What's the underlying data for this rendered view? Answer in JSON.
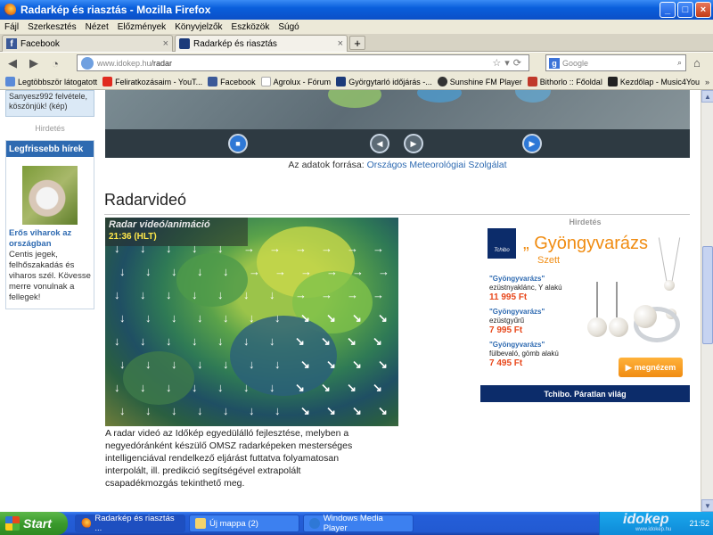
{
  "window": {
    "title": "Radarkép és riasztás - Mozilla Firefox",
    "buttons": {
      "minimize": "_",
      "maximize": "□",
      "close": "×"
    }
  },
  "menu": [
    "Fájl",
    "Szerkesztés",
    "Nézet",
    "Előzmények",
    "Könyvjelzők",
    "Eszközök",
    "Súgó"
  ],
  "tabs": [
    {
      "label": "Facebook",
      "active": false
    },
    {
      "label": "Radarkép és riasztás",
      "active": true
    }
  ],
  "navigation": {
    "url_host": "www.idokep.hu",
    "url_path": "/radar",
    "search_placeholder": "Google"
  },
  "bookmarks": [
    {
      "label": "Legtöbbször látogatott",
      "color": "#5a8ad8"
    },
    {
      "label": "Feliratkozásaim - YouT...",
      "color": "#e02a1f"
    },
    {
      "label": "Facebook",
      "color": "#3b5998"
    },
    {
      "label": "Agrolux - Fórum",
      "color": "#ffffff"
    },
    {
      "label": "Györgytarló időjárás -...",
      "color": "#1b3a7a"
    },
    {
      "label": "Sunshine FM Player",
      "color": "#333333"
    },
    {
      "label": "Bithorlo :: Főoldal",
      "color": "#c0392b"
    },
    {
      "label": "Kezdőlap - Music4You",
      "color": "#222222"
    }
  ],
  "sidebar": {
    "note_text": "Sanyesz992 felvétele, köszönjük! (kép)",
    "ad_label": "Hirdetés",
    "latest_news_title": "Legfrissebb hírek",
    "news_title": "Erős viharok az országban",
    "news_text": "Centis jegek, felhőszakadás és viharos szél. Kövesse merre vonulnak a fellegek!"
  },
  "source": {
    "prefix": "Az adatok forrása:",
    "link": "Országos Meteorológiai Szolgálat"
  },
  "radar_section": {
    "heading": "Radarvideó",
    "overlay_title": "Radar videó/animáció",
    "overlay_time": "21:36 (HLT)",
    "description": "A radar videó az Időkép egyedülálló fejlesztése, melyben a negyedóránként készülő OMSZ radarképeken mesterséges intelligenciával rendelkező eljárást futtatva folyamatosan interpolált, ill. predikció segítségével extrapolált csapadékmozgás tekinthető meg."
  },
  "ad": {
    "label": "Hirdetés",
    "brand": "Tchibo",
    "headline": "Gyöngyvarázs",
    "subhead": "Szett",
    "products": [
      {
        "name_q": "\"Gyöngyvarázs\"",
        "name": "ezüstnyaklánc, Y alakú",
        "price": "11 995 Ft"
      },
      {
        "name_q": "\"Gyöngyvarázs\"",
        "name": "ezüstgyűrű",
        "price": "7 995 Ft"
      },
      {
        "name_q": "\"Gyöngyvarázs\"",
        "name": "fülbevaló, gömb alakú",
        "price": "7 495 Ft"
      }
    ],
    "button": "megnézem",
    "footer": "Tchibo. Páratlan világ"
  },
  "taskbar": {
    "start": "Start",
    "tasks": [
      {
        "label": "Radarkép és riasztás ...",
        "active": true
      },
      {
        "label": "Új mappa (2)",
        "active": false
      },
      {
        "label": "Windows Media Player",
        "active": false
      }
    ],
    "tray_logo": "idokep",
    "tray_sub": "www.idokep.hu",
    "clock": "21:52"
  }
}
